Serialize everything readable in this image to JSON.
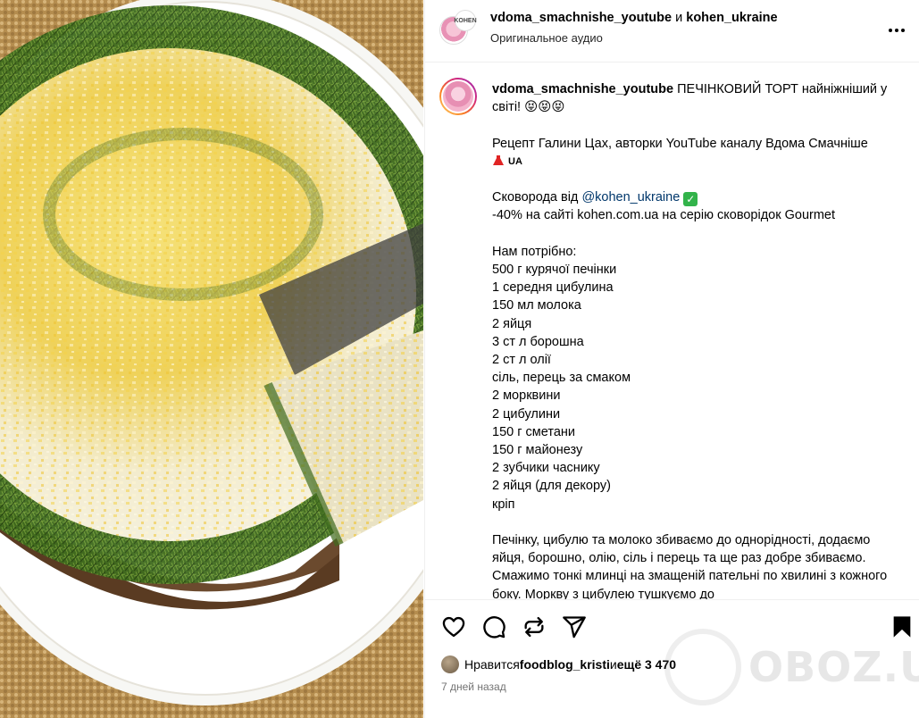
{
  "header": {
    "user1": "vdoma_smachnishe_youtube",
    "conjunction": " и ",
    "user2": "kohen_ukraine",
    "audio": "Оригинальное аудио",
    "avatar_badge": "KOHEN"
  },
  "caption": {
    "username": "vdoma_smachnishe_youtube",
    "title": " ПЕЧІНКОВИЙ ТОРТ найніжніший у світі! 😝😝😝",
    "credit": "Рецепт Галини Цах, авторки YouTube каналу Вдома Смачніше",
    "credit_flag_text": "UA",
    "pan_prefix": "Сковорода від ",
    "pan_mention": "@kohen_ukraine",
    "pan_check": "✓",
    "discount": "-40% на сайті kohen.com.ua на серію сковорідок Gourmet",
    "needed_label": "Нам потрібно:",
    "ingredients": [
      "500 г курячої печінки",
      "1 середня цибулина",
      "150 мл молока",
      "2 яйця",
      "3 ст л борошна",
      "2 ст л олії",
      "сіль, перець за смаком",
      "2 морквини",
      "2 цибулини",
      "150 г сметани",
      "150 г майонезу",
      "2 зубчики часнику",
      "2 яйця (для декору)",
      "кріп"
    ],
    "instructions": "Печінку, цибулю та молоко збиваємо до однорідності, додаємо яйця, борошно, олію, сіль і перець та ще раз добре збиваємо. Смажимо тонкі млинці на змащеній пательні по хвилині з кожного боку. Моркву з цибулею тушкуємо до"
  },
  "actions": {
    "like_icon": "heart-icon",
    "comment_icon": "comment-icon",
    "repost_icon": "repost-icon",
    "share_icon": "send-icon",
    "save_icon": "bookmark-icon"
  },
  "likes": {
    "prefix": "Нравится ",
    "user": "foodblog_kristi",
    "middle": " и ",
    "rest": "ещё 3 470"
  },
  "timestamp": "7 дней назад",
  "watermark": "OBOZ.UA",
  "colors": {
    "mention": "#00376b",
    "meta_gray": "#737373",
    "check_green": "#32b34a"
  }
}
